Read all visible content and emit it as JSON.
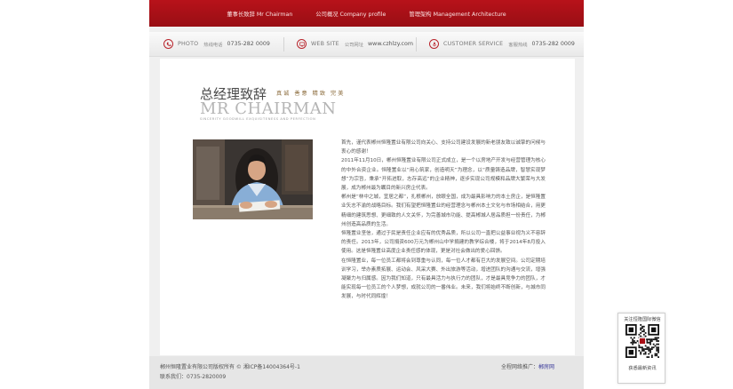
{
  "nav": {
    "items": [
      "董事长致辞  Mr Chairman",
      "公司概况  Company profile",
      "管理架构  Management Architecture"
    ]
  },
  "contact": {
    "photo": {
      "label": "PHOTO",
      "sub": "热线电话",
      "value": "0735-282 0009"
    },
    "website": {
      "label": "WEB SITE",
      "sub": "公司网址",
      "value": "www.czhlzy.com"
    },
    "service": {
      "label": "CUSTOMER SERVICE",
      "sub": "客服热线",
      "value": "0735-282 0009"
    }
  },
  "heading": {
    "title_cn": "总经理致辞",
    "tags": "真诚  善意  精致  完美",
    "title_en": "MR CHAIRMAN",
    "tagline": "SINCERITY GOODWILL EXQUISITENESS AND PERFECTION"
  },
  "article": {
    "paragraphs": [
      "首先，谨代表郴州恒隆置业有限公司向关心、支持公司建设发展的新老朋友致以诚挚的问候与衷心的感谢！",
      "2011年11月10日，郴州恒隆置业有限公司正式成立，是一个以房地产开发与经营管理为核心的中外合资企业。恒隆置业以“用心筑家，创造明天”为理念，以“质量铸造品牌，智慧实现梦想”为宗旨，秉承“开拓进取，志存高远”的企业精神，逐步实现公司规模和品牌大繁荣与大发展，成为郴州最为瞩目的新兴房企代表。",
      "郴州是“林中之城，宜居之都”，扎根郴州，放眼全国，成为最具影响力的本土房企，是恒隆置业矢志不渝的战略目标。我们有望把恒隆置业的经营理念与郴州本土文化与市场相结合，用更精细的建筑思想、更细致的人文关怀，为完善城市功能、提高郴城人居品质担一份责任，为郴州创造高品质的生活。",
      "恒隆置业坚信，通过于民是责任企业应有的优秀品质，所以公司一直把公益事业视为义不容辞的责任。2013年，公司捐资600万元为郴州山中学捐建的教学综合楼，将于2014年8月投入使用。这是恒隆置业高度企业责任感的体现，更是对社会做出的爱心回馈。",
      "在恒隆置业，每一位员工都将会到尊重与认同，每一位人才都有巨大的发展空间。公司定期培训学习，举办素质拓展、运动会、风采大赛、外出旅游等活动，增进团队的沟通与交流，增强凝聚力与归属感。因为我们知道，只有最具活力与执行力的团队，才是最具竞争力的团队，才能实现每一位员工的个人梦想，成就公司的一番伟业。未来，我们将始终不断创新，与城市同发展，与时代同辉煌！"
    ]
  },
  "footer": {
    "copyright": "郴州恒隆置业有限公司版权所有 ©    湘ICP备14004364号-1",
    "contact": "联系我们：0735-2820009",
    "promo": "全程网络推广：",
    "promo_link": "郴房网"
  },
  "qr": {
    "top": "关注恒隆国际微信",
    "bottom": "获悉最新资讯"
  },
  "colors": {
    "accent": "#a90f16",
    "tag": "#8a6a3a"
  }
}
